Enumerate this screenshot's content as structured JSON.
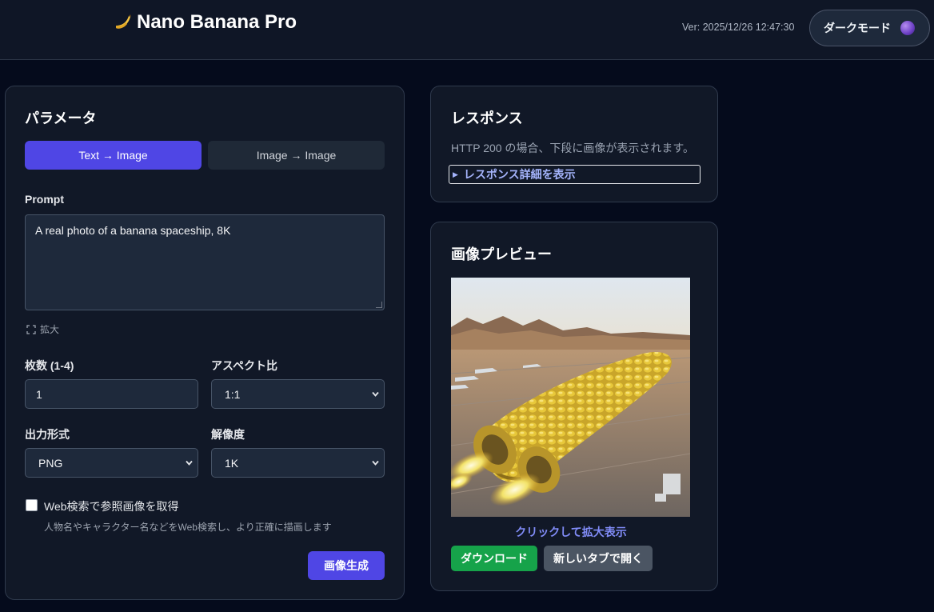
{
  "header": {
    "app_title": "Nano Banana Pro",
    "version": "Ver: 2025/12/26 12:47:30",
    "dark_mode_label": "ダークモード",
    "logo_icon": "banana-icon",
    "toggle_icon": "moon-icon"
  },
  "params": {
    "title": "パラメータ",
    "tabs": [
      {
        "label": "Text → Image",
        "active": true
      },
      {
        "label": "Image → Image",
        "active": false
      }
    ],
    "prompt_label": "Prompt",
    "prompt_value": "A real photo of a banana spaceship, 8K",
    "expand_label": "拡大",
    "count_label": "枚数 (1-4)",
    "count_value": "1",
    "aspect_label": "アスペクト比",
    "aspect_value": "1:1",
    "format_label": "出力形式",
    "format_value": "PNG",
    "resolution_label": "解像度",
    "resolution_value": "1K",
    "web_search_label": "Web検索で参照画像を取得",
    "web_search_help": "人物名やキャラクター名などをWeb検索し、より正確に描画します",
    "web_search_checked": false,
    "generate_label": "画像生成"
  },
  "response": {
    "title": "レスポンス",
    "description": "HTTP 200 の場合、下段に画像が表示されます。",
    "details_label": "レスポンス詳細を表示"
  },
  "preview": {
    "title": "画像プレビュー",
    "zoom_label": "クリックして拡大表示",
    "download_label": "ダウンロード",
    "new_tab_label": "新しいタブで開く"
  },
  "colors": {
    "accent": "#4f46e5",
    "success": "#16a34a",
    "link": "#818cf8"
  }
}
